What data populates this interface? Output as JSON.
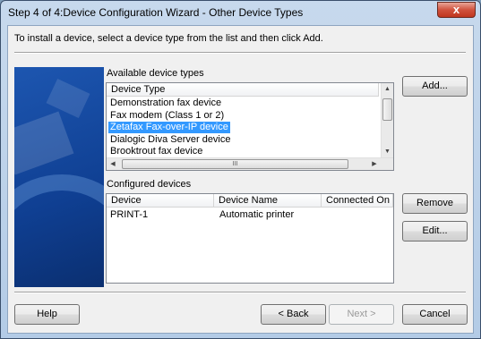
{
  "window": {
    "title": "Step 4 of 4:Device Configuration Wizard - Other Device Types",
    "close_glyph": "x"
  },
  "instruction": "To install a device, select a device type from the list and then click Add.",
  "available": {
    "label": "Available device types",
    "column": "Device Type",
    "items": [
      "Demonstration fax device",
      "Fax modem (Class 1 or 2)",
      "Zetafax Fax-over-IP device",
      "Dialogic Diva Server device",
      "Brooktrout fax device"
    ],
    "selected_index": 2,
    "hscroll_thumb_glyph": "III"
  },
  "configured": {
    "label": "Configured devices",
    "columns": [
      "Device",
      "Device Name",
      "Connected On"
    ],
    "rows": [
      {
        "device": "PRINT-1",
        "name": "Automatic printer",
        "connected": ""
      }
    ]
  },
  "buttons": {
    "add": "Add...",
    "remove": "Remove",
    "edit": "Edit...",
    "help": "Help",
    "back": "< Back",
    "next": "Next >",
    "cancel": "Cancel"
  }
}
